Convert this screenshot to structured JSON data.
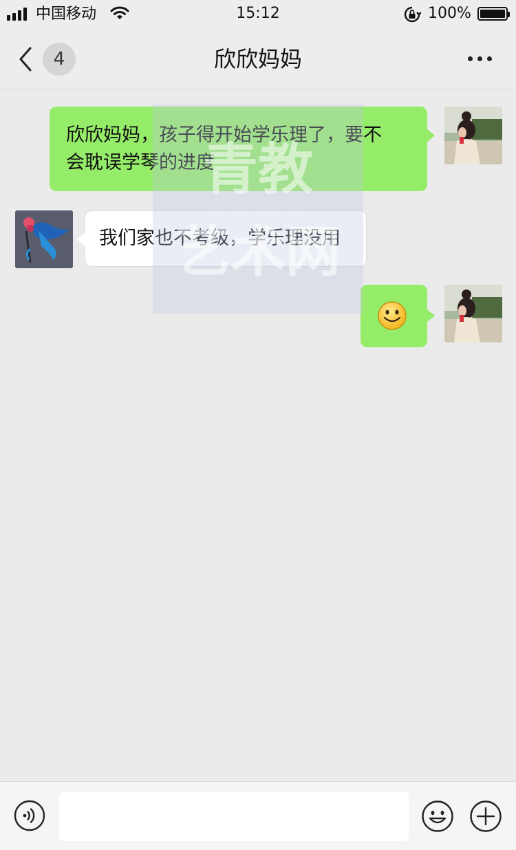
{
  "status_bar": {
    "carrier": "中国移动",
    "time": "15:12",
    "battery_percent": "100%",
    "signal_bars": 4,
    "icons": [
      "signal-icon",
      "wifi-icon",
      "rotation-lock-icon",
      "battery-icon"
    ]
  },
  "header": {
    "back_icon": "chevron-left-icon",
    "unread_count": "4",
    "title": "欣欣妈妈",
    "more_icon": "more-dots-icon"
  },
  "messages": [
    {
      "direction": "sent",
      "text": "欣欣妈妈，孩子得开始学乐理了，要不会耽误学琴的进度",
      "lines": [
        "欣欣妈妈，孩子得开始学乐理了，要不",
        "会耽误学琴的进度"
      ],
      "avatar": "girl-avatar"
    },
    {
      "direction": "received",
      "text": "我们家也不考级，学乐理没用",
      "avatar": "hummingbird-avatar"
    },
    {
      "direction": "sent",
      "emoji": "smile-emoji",
      "avatar": "girl-avatar"
    }
  ],
  "watermark": {
    "line1": "青教",
    "line2": "艺术网"
  },
  "input_bar": {
    "voice_icon": "voice-icon",
    "input_value": "",
    "emoji_icon": "smiley-icon",
    "plus_icon": "plus-icon"
  },
  "colors": {
    "background": "#ebebeb",
    "sent_bubble": "#95ec69",
    "received_bubble": "#ffffff",
    "header_bg": "#ededed"
  }
}
